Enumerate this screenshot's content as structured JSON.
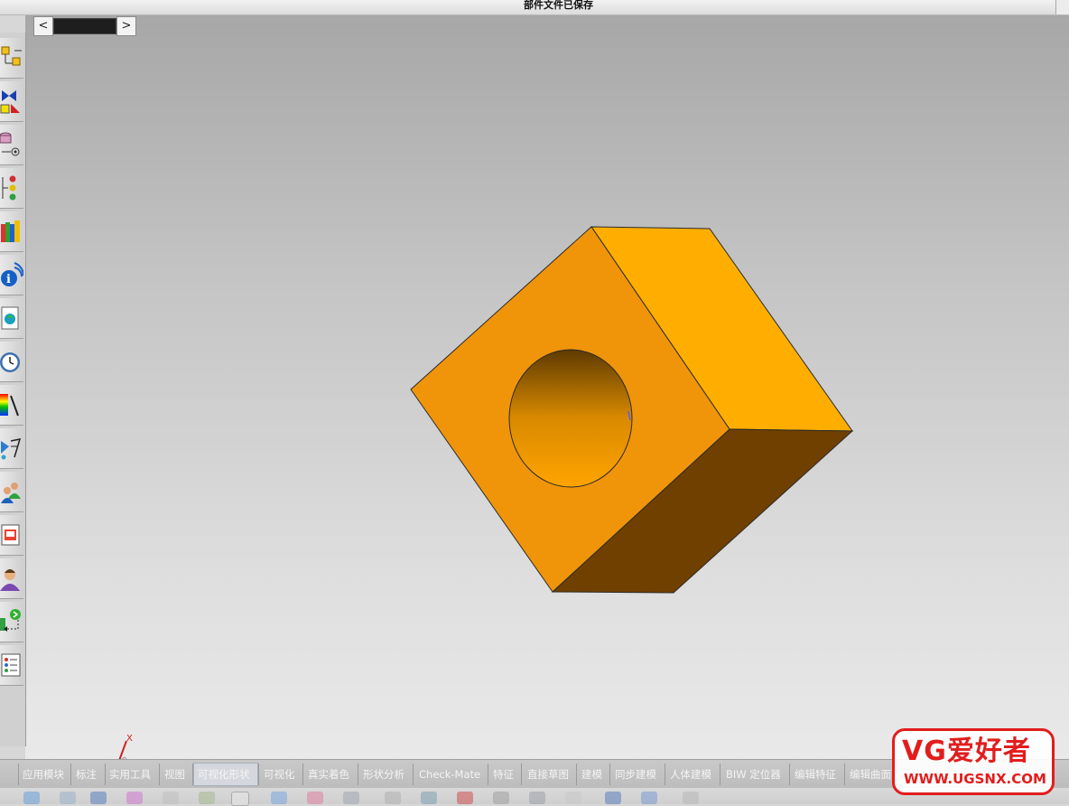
{
  "status_bar": {
    "message": "部件文件已保存"
  },
  "scroller": {
    "left_arrow": "<",
    "right_arrow": ">"
  },
  "left_toolbar": {
    "icons": [
      "assembly-icon",
      "mirror-icon",
      "database-icon",
      "tree-icon",
      "books-icon",
      "info-icon",
      "document-icon",
      "clock-icon",
      "color-palette-icon",
      "wizard-icon",
      "users-icon",
      "window-icon",
      "user-icon",
      "export-icon",
      "list-icon"
    ]
  },
  "viewport": {
    "model_colors": {
      "front_face": "#F0950A",
      "top_face": "#FFAE00",
      "side_face": "#704000",
      "hole_top": "#5E3A00",
      "hole_bottom": "#FFA400"
    },
    "triad": {
      "x_label": "X"
    }
  },
  "tabs": [
    {
      "label": "应用模块"
    },
    {
      "label": "标注"
    },
    {
      "label": "实用工具"
    },
    {
      "label": "视图"
    },
    {
      "label": "可视化形状"
    },
    {
      "label": "可视化"
    },
    {
      "label": "真实着色"
    },
    {
      "label": "形状分析"
    },
    {
      "label": "Check-Mate"
    },
    {
      "label": "特征"
    },
    {
      "label": "直接草图"
    },
    {
      "label": "建模"
    },
    {
      "label": "同步建模"
    },
    {
      "label": "人体建模"
    },
    {
      "label": "BIW 定位器"
    },
    {
      "label": "编辑特征"
    },
    {
      "label": "编辑曲面"
    }
  ],
  "active_tab": "可视化形状",
  "watermark": {
    "title": "VG爱好者",
    "url": "WWW.UGSNX.COM"
  }
}
